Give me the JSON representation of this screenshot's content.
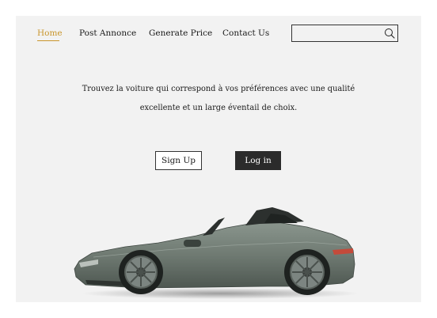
{
  "nav": {
    "items": [
      {
        "label": "Home",
        "active": true
      },
      {
        "label": "Post Annonce",
        "active": false
      },
      {
        "label": "Generate Price",
        "active": false
      },
      {
        "label": "Contact Us",
        "active": false
      }
    ]
  },
  "search": {
    "value": "",
    "placeholder": "",
    "icon": "search-icon"
  },
  "hero": {
    "tagline_line1": "Trouvez la voiture qui correspond à vos préférences avec une qualité",
    "tagline_line2": "excellente et un large éventail de choix."
  },
  "actions": {
    "signup_label": "Sign Up",
    "login_label": "Log in"
  },
  "colors": {
    "accent": "#c9962d",
    "page_background": "#f2f2f2",
    "login_background": "#2b2b2b",
    "car_body": "#6f7a72"
  }
}
